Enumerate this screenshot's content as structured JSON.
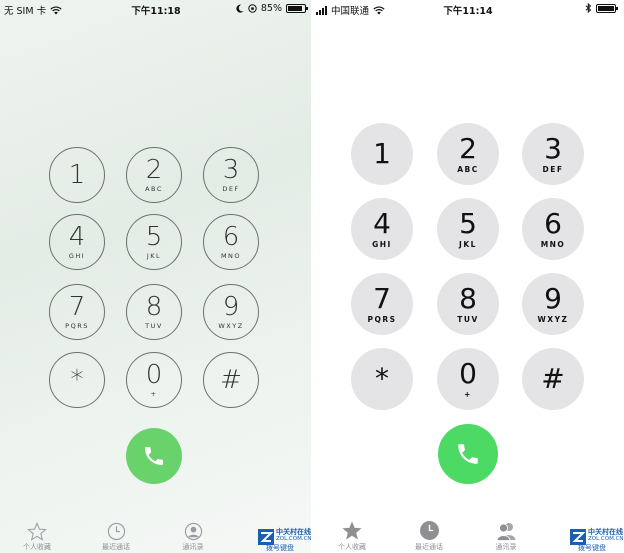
{
  "left": {
    "status": {
      "carrier": "无 SIM 卡",
      "time": "下午11:18",
      "battery": "85%",
      "battery_level": 0.85
    },
    "keys": [
      {
        "digit": "1",
        "letters": ""
      },
      {
        "digit": "2",
        "letters": "ABC"
      },
      {
        "digit": "3",
        "letters": "DEF"
      },
      {
        "digit": "4",
        "letters": "GHI"
      },
      {
        "digit": "5",
        "letters": "JKL"
      },
      {
        "digit": "6",
        "letters": "MNO"
      },
      {
        "digit": "7",
        "letters": "PQRS"
      },
      {
        "digit": "8",
        "letters": "TUV"
      },
      {
        "digit": "9",
        "letters": "WXYZ"
      },
      {
        "digit": "*",
        "letters": ""
      },
      {
        "digit": "0",
        "letters": "+"
      },
      {
        "digit": "#",
        "letters": ""
      }
    ],
    "tabs": [
      {
        "label": "个人收藏",
        "icon": "star-icon"
      },
      {
        "label": "最近通话",
        "icon": "clock-icon"
      },
      {
        "label": "通讯录",
        "icon": "contact-icon"
      }
    ],
    "watermark": {
      "brand": "中关村在线",
      "url": "ZOL.COM.CN",
      "tab_label": "拨号键盘"
    },
    "call_color": "#6ad26a"
  },
  "right": {
    "status": {
      "carrier": "中国联通",
      "time": "下午11:14"
    },
    "keys": [
      {
        "digit": "1",
        "letters": ""
      },
      {
        "digit": "2",
        "letters": "ABC"
      },
      {
        "digit": "3",
        "letters": "DEF"
      },
      {
        "digit": "4",
        "letters": "GHI"
      },
      {
        "digit": "5",
        "letters": "JKL"
      },
      {
        "digit": "6",
        "letters": "MNO"
      },
      {
        "digit": "7",
        "letters": "PQRS"
      },
      {
        "digit": "8",
        "letters": "TUV"
      },
      {
        "digit": "9",
        "letters": "WXYZ"
      },
      {
        "digit": "*",
        "letters": ""
      },
      {
        "digit": "0",
        "letters": "+"
      },
      {
        "digit": "#",
        "letters": ""
      }
    ],
    "tabs": [
      {
        "label": "个人收藏",
        "icon": "star-icon"
      },
      {
        "label": "最近通话",
        "icon": "clock-icon"
      },
      {
        "label": "通讯录",
        "icon": "contacts-icon"
      }
    ],
    "watermark": {
      "brand": "中关村在线",
      "url": "ZOL.COM.CN",
      "tab_label": "拨号键盘"
    },
    "call_color": "#4cd964"
  }
}
